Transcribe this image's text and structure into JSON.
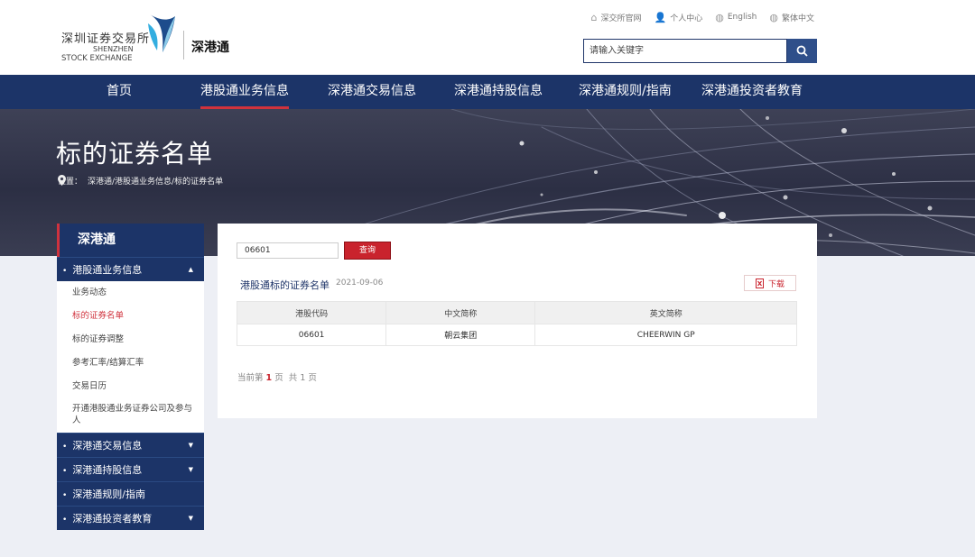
{
  "header": {
    "logo_cn": "深圳证券交易所",
    "logo_en_line1": "SHENZHEN",
    "logo_en_line2": "STOCK EXCHANGE",
    "site_name": "深港通",
    "top_links": [
      {
        "label": "深交所官网",
        "icon": "home-icon"
      },
      {
        "label": "个人中心",
        "icon": "person-icon"
      },
      {
        "label": "English",
        "icon": "globe-icon"
      },
      {
        "label": "繁体中文",
        "icon": "globe-icon"
      }
    ],
    "search_placeholder": "请输入关键字"
  },
  "nav": {
    "items": [
      {
        "label": "首页"
      },
      {
        "label": "港股通业务信息"
      },
      {
        "label": "深港通交易信息"
      },
      {
        "label": "深港通持股信息"
      },
      {
        "label": "深港通规则/指南"
      },
      {
        "label": "深港通投资者教育"
      }
    ]
  },
  "banner": {
    "title": "标的证券名单",
    "breadcrumb_prefix": "位置：",
    "breadcrumb": "深港通/港股通业务信息/标的证券名单"
  },
  "sidebar": {
    "head": "深港通",
    "groups": [
      {
        "label": "港股通业务信息",
        "expanded": true
      },
      {
        "label": "深港通交易信息"
      },
      {
        "label": "深港通持股信息"
      },
      {
        "label": "深港通规则/指南"
      },
      {
        "label": "深港通投资者教育"
      }
    ],
    "sub_items": [
      {
        "label": "业务动态"
      },
      {
        "label": "标的证券名单"
      },
      {
        "label": "标的证券调整"
      },
      {
        "label": "参考汇率/结算汇率"
      },
      {
        "label": "交易日历"
      },
      {
        "label": "开通港股通业务证券公司及参与人"
      }
    ]
  },
  "main": {
    "code_value": "06601",
    "query_label": "查询",
    "list_title": "港股通标的证券名单",
    "list_date": "2021-09-06",
    "download_label": "下载",
    "table": {
      "headers": [
        "港股代码",
        "中文简称",
        "英文简称"
      ],
      "rows": [
        [
          "06601",
          "朝云集团",
          "CHEERWIN GP"
        ]
      ]
    },
    "pager": {
      "prefix": "当前第",
      "current": "1",
      "mid": "页",
      "total_prefix": "共",
      "total": "1",
      "suffix": "页"
    }
  },
  "colors": {
    "nav_bg": "#1c3468",
    "accent_red": "#c9232d",
    "page_bg": "#edeff5"
  }
}
